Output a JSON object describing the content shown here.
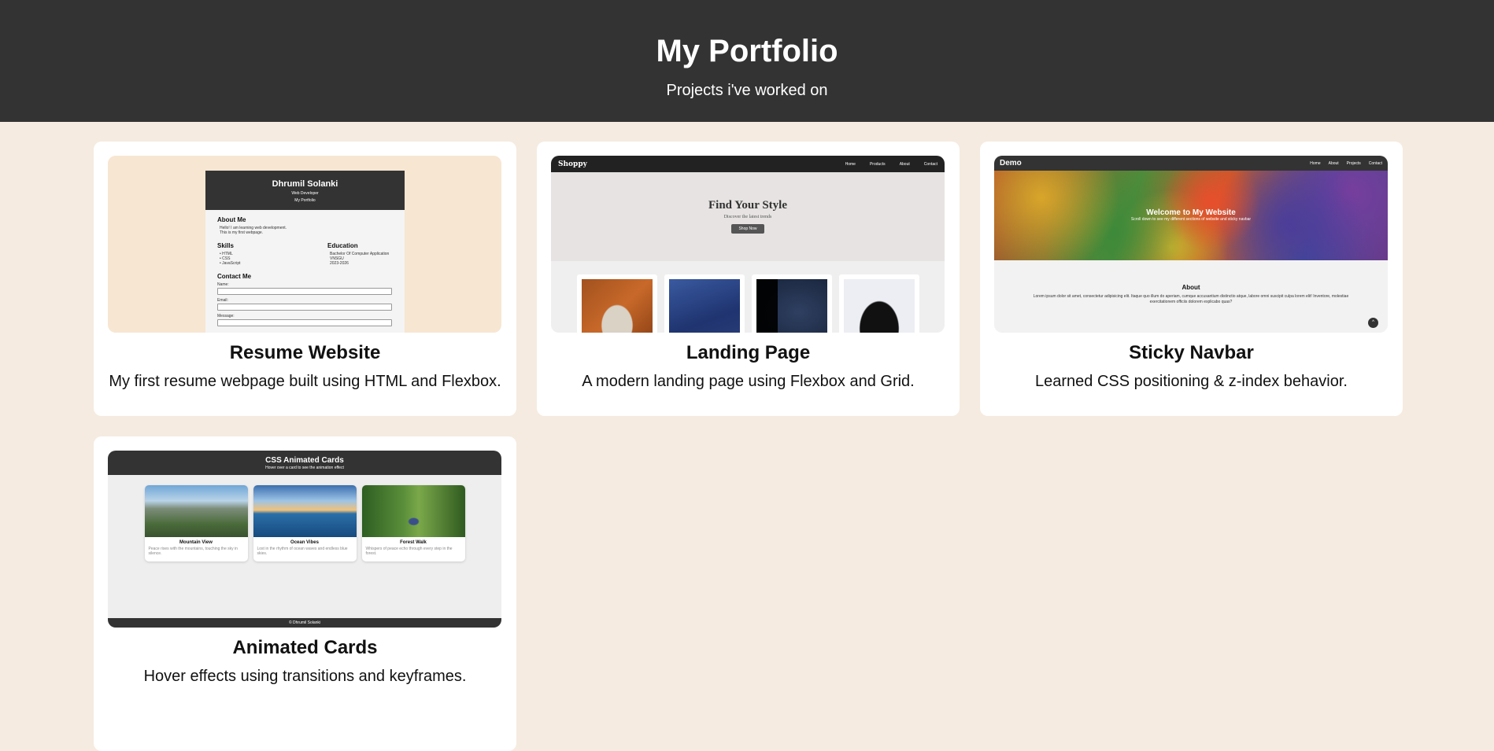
{
  "header": {
    "title": "My Portfolio",
    "subtitle": "Projects i've worked on"
  },
  "projects": [
    {
      "title": "Resume Website",
      "description": "My first resume webpage built using HTML and Flexbox.",
      "preview": {
        "name": "Dhrumil Solanki",
        "role": "Web Developer",
        "tag": "My Portfolio",
        "about_heading": "About Me",
        "about_lines": [
          "Hello! I am learning web development.",
          "This is my first webpage."
        ],
        "skills_heading": "Skills",
        "skills": [
          "HTML",
          "CSS",
          "JavaScript"
        ],
        "education_heading": "Education",
        "education": [
          "Bachelor Of Computer Application",
          "VNSGU",
          "2023-2026"
        ],
        "contact_heading": "Contact Me",
        "contact_fields": [
          "Name:",
          "Email:",
          "Message:"
        ]
      }
    },
    {
      "title": "Landing Page",
      "description": "A modern landing page using Flexbox and Grid.",
      "preview": {
        "brand": "Shoppy",
        "nav": [
          "Home",
          "Products",
          "About",
          "Contact"
        ],
        "hero_title": "Find Your Style",
        "hero_sub": "Discover the latest trends",
        "hero_button": "Shop Now"
      }
    },
    {
      "title": "Sticky Navbar",
      "description": "Learned CSS positioning & z-index behavior.",
      "preview": {
        "brand": "Demo",
        "nav": [
          "Home",
          "About",
          "Projects",
          "Contact"
        ],
        "hero_title": "Welcome to My Website",
        "hero_sub": "Scroll down to see my different sections of website and sticky navbar",
        "about_heading": "About",
        "about_text": "Lorem ipsum dolor sit amet, consectetur adipisicing elit. Itaque quo illum do aperiam, cumque accusantium distinctio atque, labore omni suscipit culpa lorem elit! Inventore, molestiae exercitationem officiis dolorem explicabo quas?",
        "top_button": "^"
      }
    },
    {
      "title": "Animated Cards",
      "description": "Hover effects using transitions and keyframes.",
      "preview": {
        "heading": "CSS Animated Cards",
        "sub": "Hover over a card to see the animation effect",
        "cards": [
          {
            "title": "Mountain View",
            "text": "Peace rises with the mountains, touching the sky in silence."
          },
          {
            "title": "Ocean Vibes",
            "text": "Lost in the rhythm of ocean waves and endless blue skies."
          },
          {
            "title": "Forest Walk",
            "text": "Whispers of peace echo through every step in the forest."
          }
        ],
        "footer": "© Dhrumil Solanki"
      }
    }
  ]
}
